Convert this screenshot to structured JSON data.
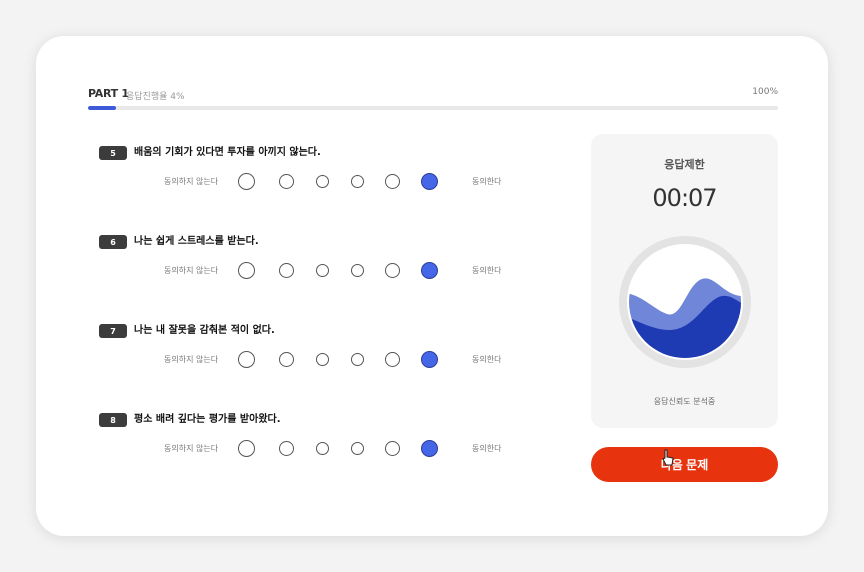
{
  "header": {
    "part": "PART 1",
    "rate_label": "응답진행율 4%",
    "percent_label": "100%",
    "progress": 0.04
  },
  "questions": [
    {
      "number": "5",
      "text": "배움의 기회가 있다면 투자를 아끼지 않는다.",
      "left_label": "동의하지 않는다",
      "right_label": "동의한다",
      "selected": 6
    },
    {
      "number": "6",
      "text": "나는 쉽게 스트레스를 받는다.",
      "left_label": "동의하지 않는다",
      "right_label": "동의한다",
      "selected": 6
    },
    {
      "number": "7",
      "text": "나는 내 잘못을 감춰본 적이 없다.",
      "left_label": "동의하지 않는다",
      "right_label": "동의한다",
      "selected": 6
    },
    {
      "number": "8",
      "text": "평소 배려 깊다는 평가를 받아왔다.",
      "left_label": "동의하지 않는다",
      "right_label": "동의한다",
      "selected": 6
    }
  ],
  "timer": {
    "title": "응답제한",
    "value": "00:07",
    "status": "응답신뢰도 분석중"
  },
  "next_button": {
    "label": "다음 문제"
  },
  "colors": {
    "accent": "#3d5bd9",
    "selected": "#4666e8",
    "button": "#e8330f",
    "wave_dark": "#1f3bb3",
    "wave_light": "#6f86d9"
  }
}
